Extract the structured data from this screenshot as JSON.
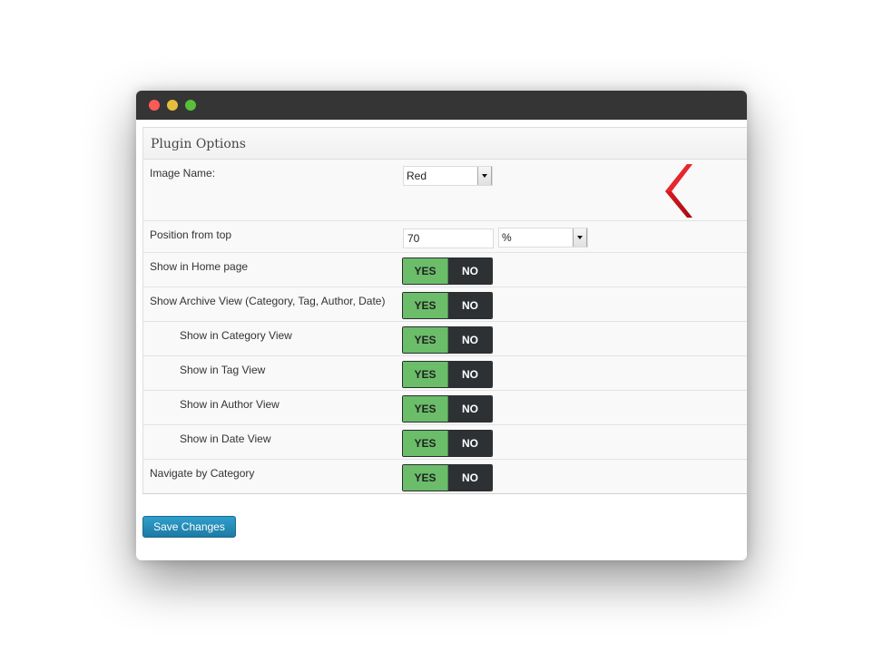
{
  "panel": {
    "title": "Plugin Options"
  },
  "image_name": {
    "label": "Image Name:",
    "value": "Red"
  },
  "arrow_preview": {
    "icon": "red-chevron-left-icon",
    "color": "#c4161c"
  },
  "position": {
    "label": "Position from top",
    "value": "70",
    "unit": "%"
  },
  "toggles": [
    {
      "label": "Show in Home page",
      "yes": "YES",
      "no": "NO",
      "selected": "YES"
    },
    {
      "label": "Show Archive View (Category, Tag, Author, Date)",
      "yes": "YES",
      "no": "NO",
      "selected": "YES"
    },
    {
      "label": "Show in Category View",
      "yes": "YES",
      "no": "NO",
      "selected": "YES"
    },
    {
      "label": "Show in Tag View",
      "yes": "YES",
      "no": "NO",
      "selected": "YES"
    },
    {
      "label": "Show in Author View",
      "yes": "YES",
      "no": "NO",
      "selected": "YES"
    },
    {
      "label": "Show in Date View",
      "yes": "YES",
      "no": "NO",
      "selected": "YES"
    },
    {
      "label": "Navigate by Category",
      "yes": "YES",
      "no": "NO",
      "selected": "YES"
    }
  ],
  "save_button": {
    "label": "Save Changes"
  },
  "colors": {
    "yes_bg": "#6bbd6a",
    "no_bg": "#2e3134",
    "button": "#2387b4",
    "titlebar": "#353535"
  }
}
